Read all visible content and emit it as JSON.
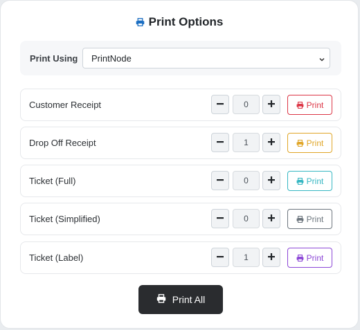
{
  "header": {
    "title": "Print Options",
    "accent_color": "#1b6ec2"
  },
  "print_using": {
    "label": "Print Using",
    "selected": "PrintNode"
  },
  "rows": [
    {
      "label": "Customer Receipt",
      "quantity": "0",
      "print_label": "Print",
      "color": "#dc3545"
    },
    {
      "label": "Drop Off Receipt",
      "quantity": "1",
      "print_label": "Print",
      "color": "#e0a526"
    },
    {
      "label": "Ticket (Full)",
      "quantity": "0",
      "print_label": "Print",
      "color": "#35b6c2"
    },
    {
      "label": "Ticket (Simplified)",
      "quantity": "0",
      "print_label": "Print",
      "color": "#6c757d"
    },
    {
      "label": "Ticket (Label)",
      "quantity": "1",
      "print_label": "Print",
      "color": "#8b45d6"
    }
  ],
  "print_all": {
    "label": "Print All"
  },
  "icons": {
    "title": "printer-icon",
    "row_print": "printer-icon",
    "minus": "minus-icon",
    "plus": "plus-icon",
    "select": "chevron-down-icon"
  }
}
